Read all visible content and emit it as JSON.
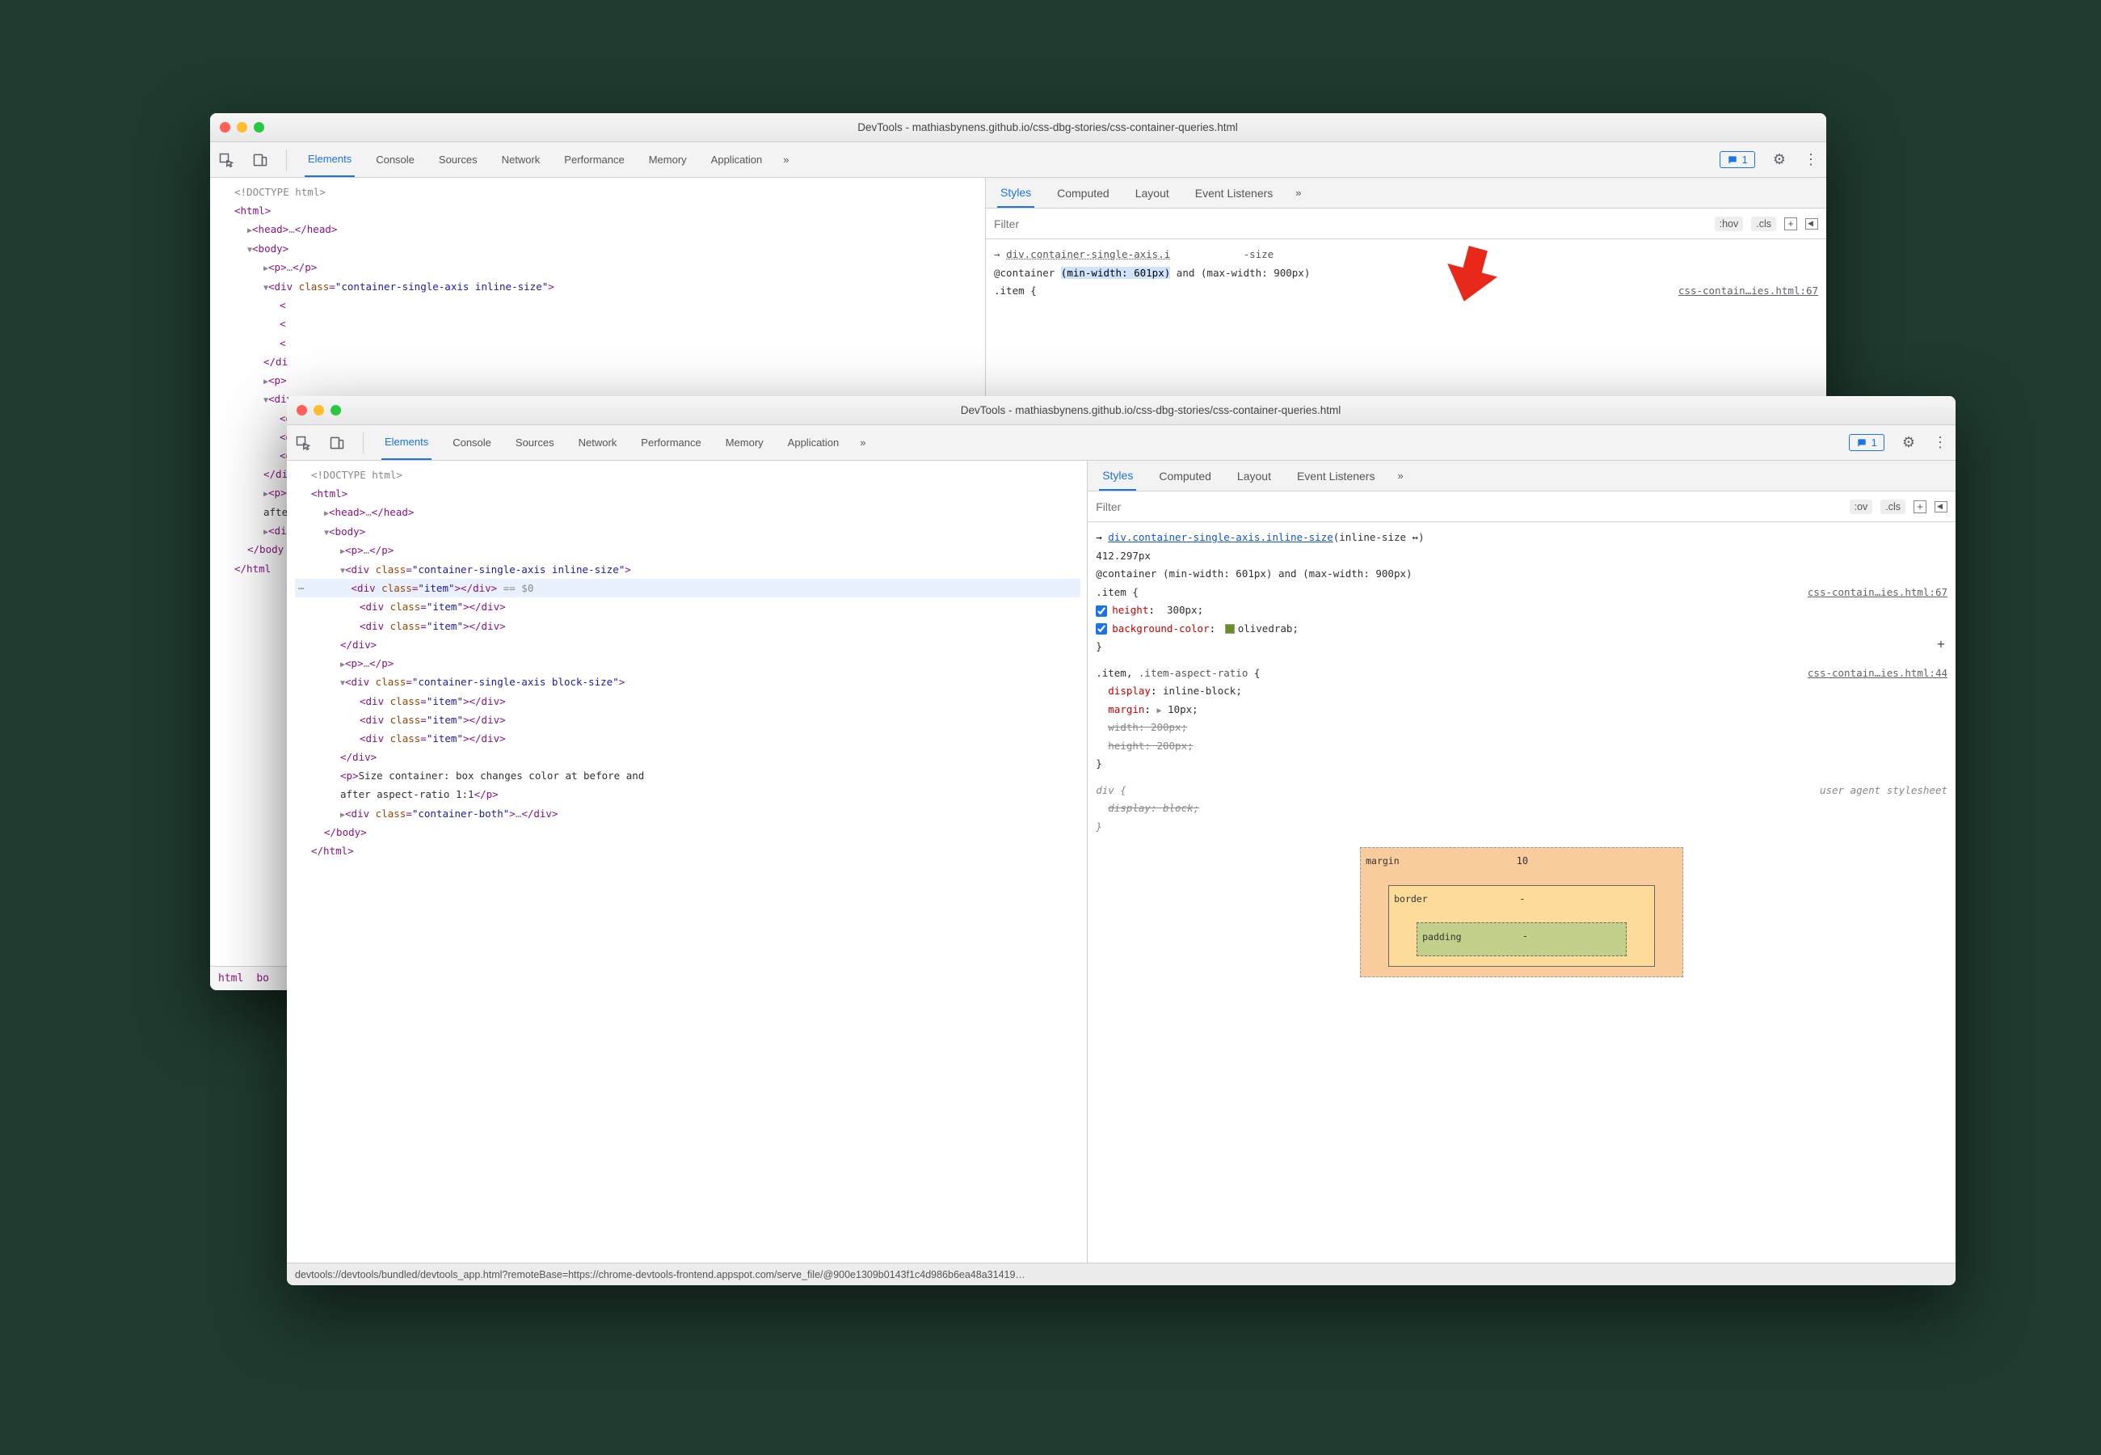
{
  "window1": {
    "title": "DevTools - mathiasbynens.github.io/css-dbg-stories/css-container-queries.html",
    "tabs": [
      "Elements",
      "Console",
      "Sources",
      "Network",
      "Performance",
      "Memory",
      "Application"
    ],
    "activeTab": "Elements",
    "badge": "1",
    "subtabs": [
      "Styles",
      "Computed",
      "Layout",
      "Event Listeners"
    ],
    "activeSubtab": "Styles",
    "filterPlaceholder": "Filter",
    "hov": ":hov",
    "cls": ".cls",
    "dom": {
      "doctype": "<!DOCTYPE html>",
      "html_open": "<html>",
      "head": "▶<head>…</head>",
      "body_open": "▼<body>",
      "p1": "▶<p>…</p>",
      "div_open": "▼<div class=\"container-single-axis inline-size\">",
      "html_label": "html",
      "boo_label": "boo"
    },
    "partialRows": [
      "<",
      "<",
      "<",
      "</di",
      "▶<p>",
      "▼<div",
      "<d",
      "<d",
      "<d",
      "</di",
      "▶<p>S",
      "afte",
      "▶<div",
      "</body",
      "</html"
    ],
    "styles": {
      "selectorChain": "→ div.container-single-axis.i                size",
      "container": "@container (min-width: 601px) and (max-width: 900px)",
      "selectorHighlighted": "(min-width: 601px)",
      "itemOpen": ".item {",
      "src": "css-contain…ies.html:67"
    },
    "breadcrumb": [
      "html",
      "boo"
    ]
  },
  "window2": {
    "title": "DevTools - mathiasbynens.github.io/css-dbg-stories/css-container-queries.html",
    "tabs": [
      "Elements",
      "Console",
      "Sources",
      "Network",
      "Performance",
      "Memory",
      "Application"
    ],
    "activeTab": "Elements",
    "badge": "1",
    "subtabs": [
      "Styles",
      "Computed",
      "Layout",
      "Event Listeners"
    ],
    "activeSubtab": "Styles",
    "filterPlaceholder": "Filter",
    "hov": ":ov",
    "cls": ".cls",
    "dom": {
      "doctype": "<!DOCTYPE html>",
      "html_open": "<html>",
      "head": "▶<head>…</head>",
      "body_open": "▼<body>",
      "p1": "▶<p>…</p>",
      "div1_open": "▼<div class=\"container-single-axis inline-size\">",
      "item_sel": "<div class=\"item\"></div> == $0",
      "item2": "<div class=\"item\"></div>",
      "item3": "<div class=\"item\"></div>",
      "div1_close": "</div>",
      "p2": "▶<p>…</p>",
      "div2_open": "▼<div class=\"container-single-axis block-size\">",
      "item4": "<div class=\"item\"></div>",
      "item5": "<div class=\"item\"></div>",
      "item6": "<div class=\"item\"></div>",
      "div2_close": "</div>",
      "p3a": "<p>Size container: box changes color at before and",
      "p3b": "after aspect-ratio 1:1</p>",
      "div3": "▶<div class=\"container-both\">…</div>",
      "body_close": "</body>",
      "html_close": "</html>"
    },
    "styles": {
      "chain_link": "div.container-single-axis.inline-size",
      "chain_suffix": "(inline-size ↔)",
      "chain_px": "412.297px",
      "container": "@container (min-width: 601px) and (max-width: 900px)",
      "itemOpen": ".item {",
      "src1": "css-contain…ies.html:67",
      "props1": [
        {
          "name": "height",
          "value": "300px;"
        },
        {
          "name": "background-color",
          "value": "olivedrab;"
        }
      ],
      "close1": "}",
      "sel2": ".item, ",
      "sel2dim": ".item-aspect-ratio",
      "sel2open": " {",
      "src2": "css-contain…ies.html:44",
      "props2": [
        {
          "name": "display",
          "value": "inline-block;",
          "strike": false
        },
        {
          "name": "margin",
          "value": "10px;",
          "expand": true,
          "strike": false
        },
        {
          "name": "width",
          "value": "200px;",
          "strike": true
        },
        {
          "name": "height",
          "value": "200px;",
          "strike": true
        }
      ],
      "close2": "}",
      "uaSel": "div {",
      "uaSrc": "user agent stylesheet",
      "uaProps": [
        {
          "name": "display",
          "value": "block;",
          "strike": true
        }
      ],
      "uaClose": "}"
    },
    "boxModel": {
      "margin_label": "margin",
      "margin_top": "10",
      "border_label": "border",
      "border_top": "-",
      "padding_label": "padding",
      "padding_top": "-"
    },
    "status": "devtools://devtools/bundled/devtools_app.html?remoteBase=https://chrome-devtools-frontend.appspot.com/serve_file/@900e1309b0143f1c4d986b6ea48a31419…"
  }
}
